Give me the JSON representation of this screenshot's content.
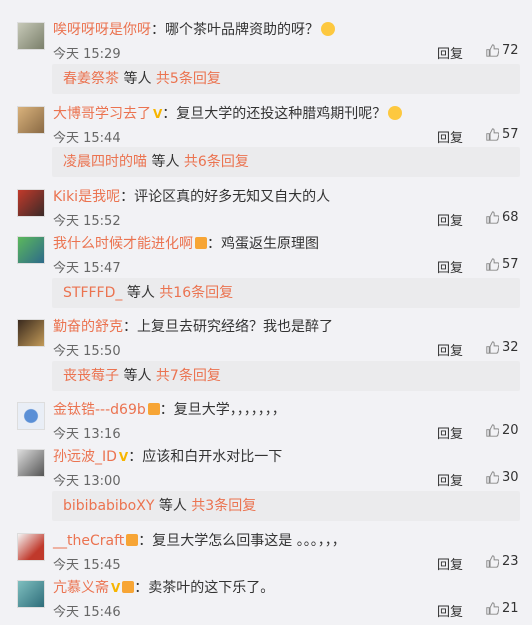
{
  "top_cut_text": "...（第一行被截断）",
  "comments": [
    {
      "user": "唉呀呀呀是你呀",
      "text": "：哪个茶叶品牌资助的呀？",
      "time": "今天 15:29",
      "reply": "回复",
      "likes": "72",
      "badges": [],
      "emoji": true
    },
    {
      "user": "大博哥学习去了",
      "text": "：复旦大学的还投这种腊鸡期刊呢？",
      "time": "今天 15:44",
      "reply": "回复",
      "likes": "57",
      "badges": [
        "v"
      ],
      "emoji": true
    },
    {
      "user": "Kiki是我呢",
      "text": "：评论区真的好多无知又自大的人",
      "time": "今天 15:52",
      "reply": "回复",
      "likes": "68",
      "badges": [],
      "emoji": false
    },
    {
      "user": "我什么时候才能进化啊",
      "text": "：鸡蛋返生原理图",
      "time": "今天 15:47",
      "reply": "回复",
      "likes": "57",
      "badges": [
        "lv"
      ],
      "emoji": false
    },
    {
      "user": "勤奋的舒克",
      "text": "：上复旦去研究经络？我也是醉了",
      "time": "今天 15:50",
      "reply": "回复",
      "likes": "32",
      "badges": [],
      "emoji": false
    },
    {
      "user": "金钛锆---d69b",
      "text": "：复旦大学，，，，，，，",
      "time": "今天 13:16",
      "reply": "回复",
      "likes": "20",
      "badges": [
        "lv"
      ],
      "emoji": false
    },
    {
      "user": "孙远波_ID",
      "text": "：应该和白开水对比一下",
      "time": "今天 13:00",
      "reply": "回复",
      "likes": "30",
      "badges": [
        "v"
      ],
      "emoji": false
    },
    {
      "user": "__theCraft",
      "text": "：复旦大学怎么回事这是 。。。，，，",
      "time": "今天 15:45",
      "reply": "回复",
      "likes": "23",
      "badges": [
        "lv"
      ],
      "emoji": false
    },
    {
      "user": "亢慕义斋",
      "text": "：卖茶叶的这下乐了。",
      "time": "今天 15:46",
      "reply": "回复",
      "likes": "21",
      "badges": [
        "v",
        "lv"
      ],
      "emoji": false
    }
  ],
  "sub_replies": [
    {
      "name": "春姜祭茶",
      "mid": " 等人 ",
      "total": "共5条回复"
    },
    {
      "name": "凌晨四时的喵",
      "mid": " 等人 ",
      "total": "共6条回复"
    },
    {
      "name": "STFFFD_",
      "mid": " 等人 ",
      "total": "共16条回复"
    },
    {
      "name": "丧丧莓子",
      "mid": " 等人 ",
      "total": "共7条回复"
    },
    {
      "name": "bibibabiboXY",
      "mid": " 等人 ",
      "total": "共3条回复"
    }
  ],
  "colors": {
    "accent": "#eb7350",
    "bg": "#f2f2f5",
    "sub_bg": "#ebebed"
  },
  "icons": {
    "like": "thumbs-up-icon",
    "verified": "v-badge-icon",
    "level": "level-badge-icon",
    "emoji": "emoji-icon"
  }
}
